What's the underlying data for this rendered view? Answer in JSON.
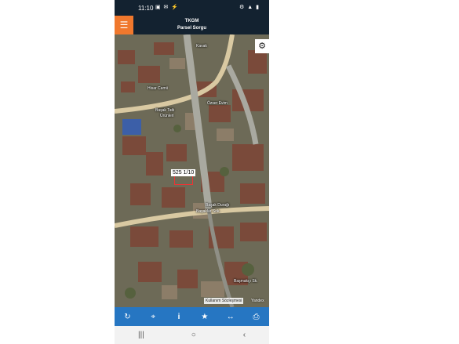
{
  "status": {
    "time": "11:10",
    "left_icons": "▣ ✉ ⚡",
    "right_icons": "⚙ ▲ ▮"
  },
  "header": {
    "menu_icon": "☰",
    "title": "TKGM",
    "subtitle": "Parsel Sorgu"
  },
  "map": {
    "settings_icon": "⚙",
    "parcel_label": "525 1/10",
    "labels": {
      "mosque": "Hisar Camii",
      "kindergarten": "Başak Tatlı",
      "kindergarten2": "Ürünleri",
      "ozser": "Özser Evim",
      "basak": "Başak Durağı",
      "street1": "Başaklar Sok.",
      "street2": "Başmakçı Sk.",
      "top_road": "Kavak"
    },
    "attribution": "Kullanım Sözleşmesi",
    "attribution_suffix": "Yandex"
  },
  "toolbar": {
    "refresh_icon": "↻",
    "locate_icon": "⌖",
    "info_icon": "i",
    "favorite_icon": "★",
    "measure_icon": "↔",
    "print_icon": "⎙"
  },
  "navbar": {
    "recents_icon": "|||",
    "home_icon": "○",
    "back_icon": "‹"
  }
}
